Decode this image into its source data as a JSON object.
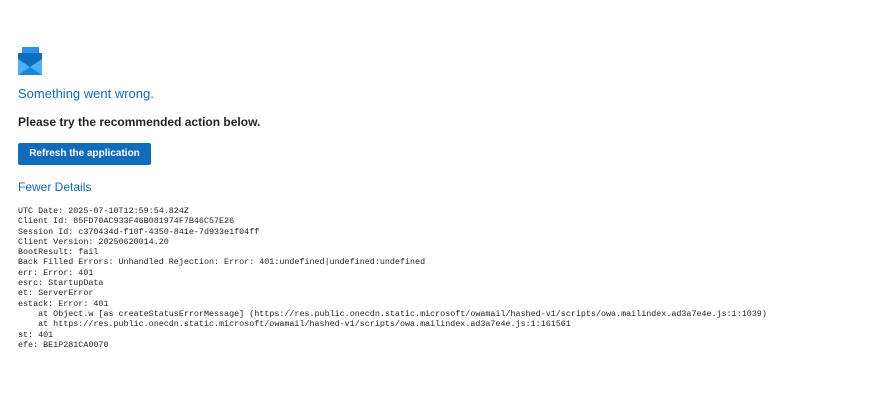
{
  "app": {
    "icon": "outlook-envelope-icon",
    "colors": {
      "accent": "#0f6cbd",
      "text": "#242424",
      "background": "#ffffff"
    }
  },
  "error": {
    "headline": "Something went wrong.",
    "instruction": "Please try the recommended action below.",
    "refresh_button_label": "Refresh the application",
    "details_toggle_label": "Fewer Details"
  },
  "details_lines": [
    "UTC Date: 2025-07-10T12:59:54.824Z",
    "Client Id: 85FD70AC933F46B081974F7B46C57E26",
    "Session Id: c370434d-f10f-4350-841e-7d933e1f04ff",
    "Client Version: 20250620014.20",
    "BootResult: fail",
    "Back Filled Errors: Unhandled Rejection: Error: 401:undefined|undefined:undefined",
    "err: Error: 401",
    "esrc: StartupData",
    "et: ServerError",
    "estack: Error: 401",
    "    at Object.w [as createStatusErrorMessage] (https://res.public.onecdn.static.microsoft/owamail/hashed-v1/scripts/owa.mailindex.ad3a7e4e.js:1:1039)",
    "    at https://res.public.onecdn.static.microsoft/owamail/hashed-v1/scripts/owa.mailindex.ad3a7e4e.js:1:161561",
    "st: 401",
    "efe: BE1P281CA0070"
  ]
}
